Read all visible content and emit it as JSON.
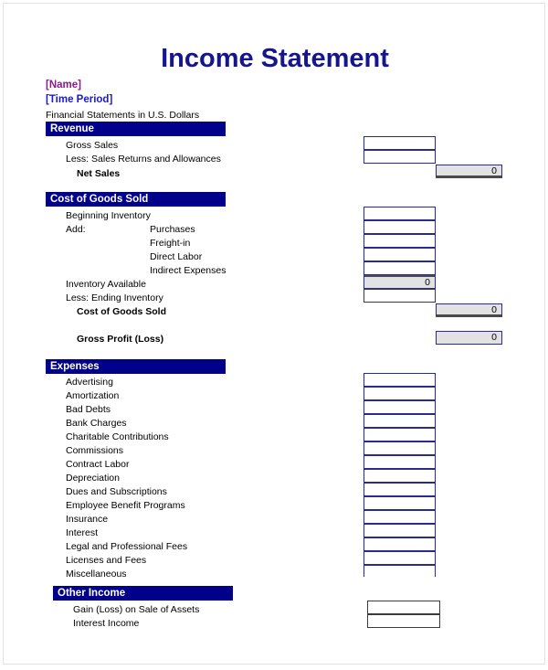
{
  "document": {
    "title": "Income Statement",
    "name_placeholder": "[Name]",
    "time_period_placeholder": "[Time Period]",
    "currency_note": "Financial Statements in U.S. Dollars"
  },
  "colors": {
    "title": "#15158c",
    "section_bar": "#00008b",
    "name": "#8b1a8b",
    "period": "#1a1acc",
    "total_fill": "#e2e2e2",
    "box_border": "#2b2b8f"
  },
  "sections": {
    "revenue": {
      "heading": "Revenue",
      "rows": [
        {
          "label": "Gross Sales",
          "value": ""
        },
        {
          "label": "Less: Sales Returns and Allowances",
          "value": ""
        },
        {
          "label": "Net Sales",
          "value": "0"
        }
      ]
    },
    "cogs": {
      "heading": "Cost of Goods Sold",
      "rows": [
        {
          "label": "Beginning Inventory",
          "value": ""
        },
        {
          "label": "Add:",
          "value": ""
        },
        {
          "label": "Purchases",
          "value": ""
        },
        {
          "label": "Freight-in",
          "value": ""
        },
        {
          "label": "Direct Labor",
          "value": ""
        },
        {
          "label": "Indirect Expenses",
          "value": ""
        },
        {
          "label": "Inventory Available",
          "value": "0"
        },
        {
          "label": "Less: Ending Inventory",
          "value": ""
        },
        {
          "label": "Cost of Goods Sold",
          "value": "0"
        },
        {
          "label": "Gross Profit (Loss)",
          "value": "0"
        }
      ]
    },
    "expenses": {
      "heading": "Expenses",
      "rows": [
        {
          "label": "Advertising",
          "value": ""
        },
        {
          "label": "Amortization",
          "value": ""
        },
        {
          "label": "Bad Debts",
          "value": ""
        },
        {
          "label": "Bank Charges",
          "value": ""
        },
        {
          "label": "Charitable Contributions",
          "value": ""
        },
        {
          "label": "Commissions",
          "value": ""
        },
        {
          "label": "Contract Labor",
          "value": ""
        },
        {
          "label": "Depreciation",
          "value": ""
        },
        {
          "label": "Dues and Subscriptions",
          "value": ""
        },
        {
          "label": "Employee Benefit Programs",
          "value": ""
        },
        {
          "label": "Insurance",
          "value": ""
        },
        {
          "label": "Interest",
          "value": ""
        },
        {
          "label": "Legal and Professional Fees",
          "value": ""
        },
        {
          "label": "Licenses and Fees",
          "value": ""
        },
        {
          "label": "Miscellaneous",
          "value": ""
        }
      ]
    },
    "other_income": {
      "heading": "Other Income",
      "rows": [
        {
          "label": "Gain (Loss) on Sale of Assets",
          "value": ""
        },
        {
          "label": "Interest Income",
          "value": ""
        }
      ]
    }
  }
}
